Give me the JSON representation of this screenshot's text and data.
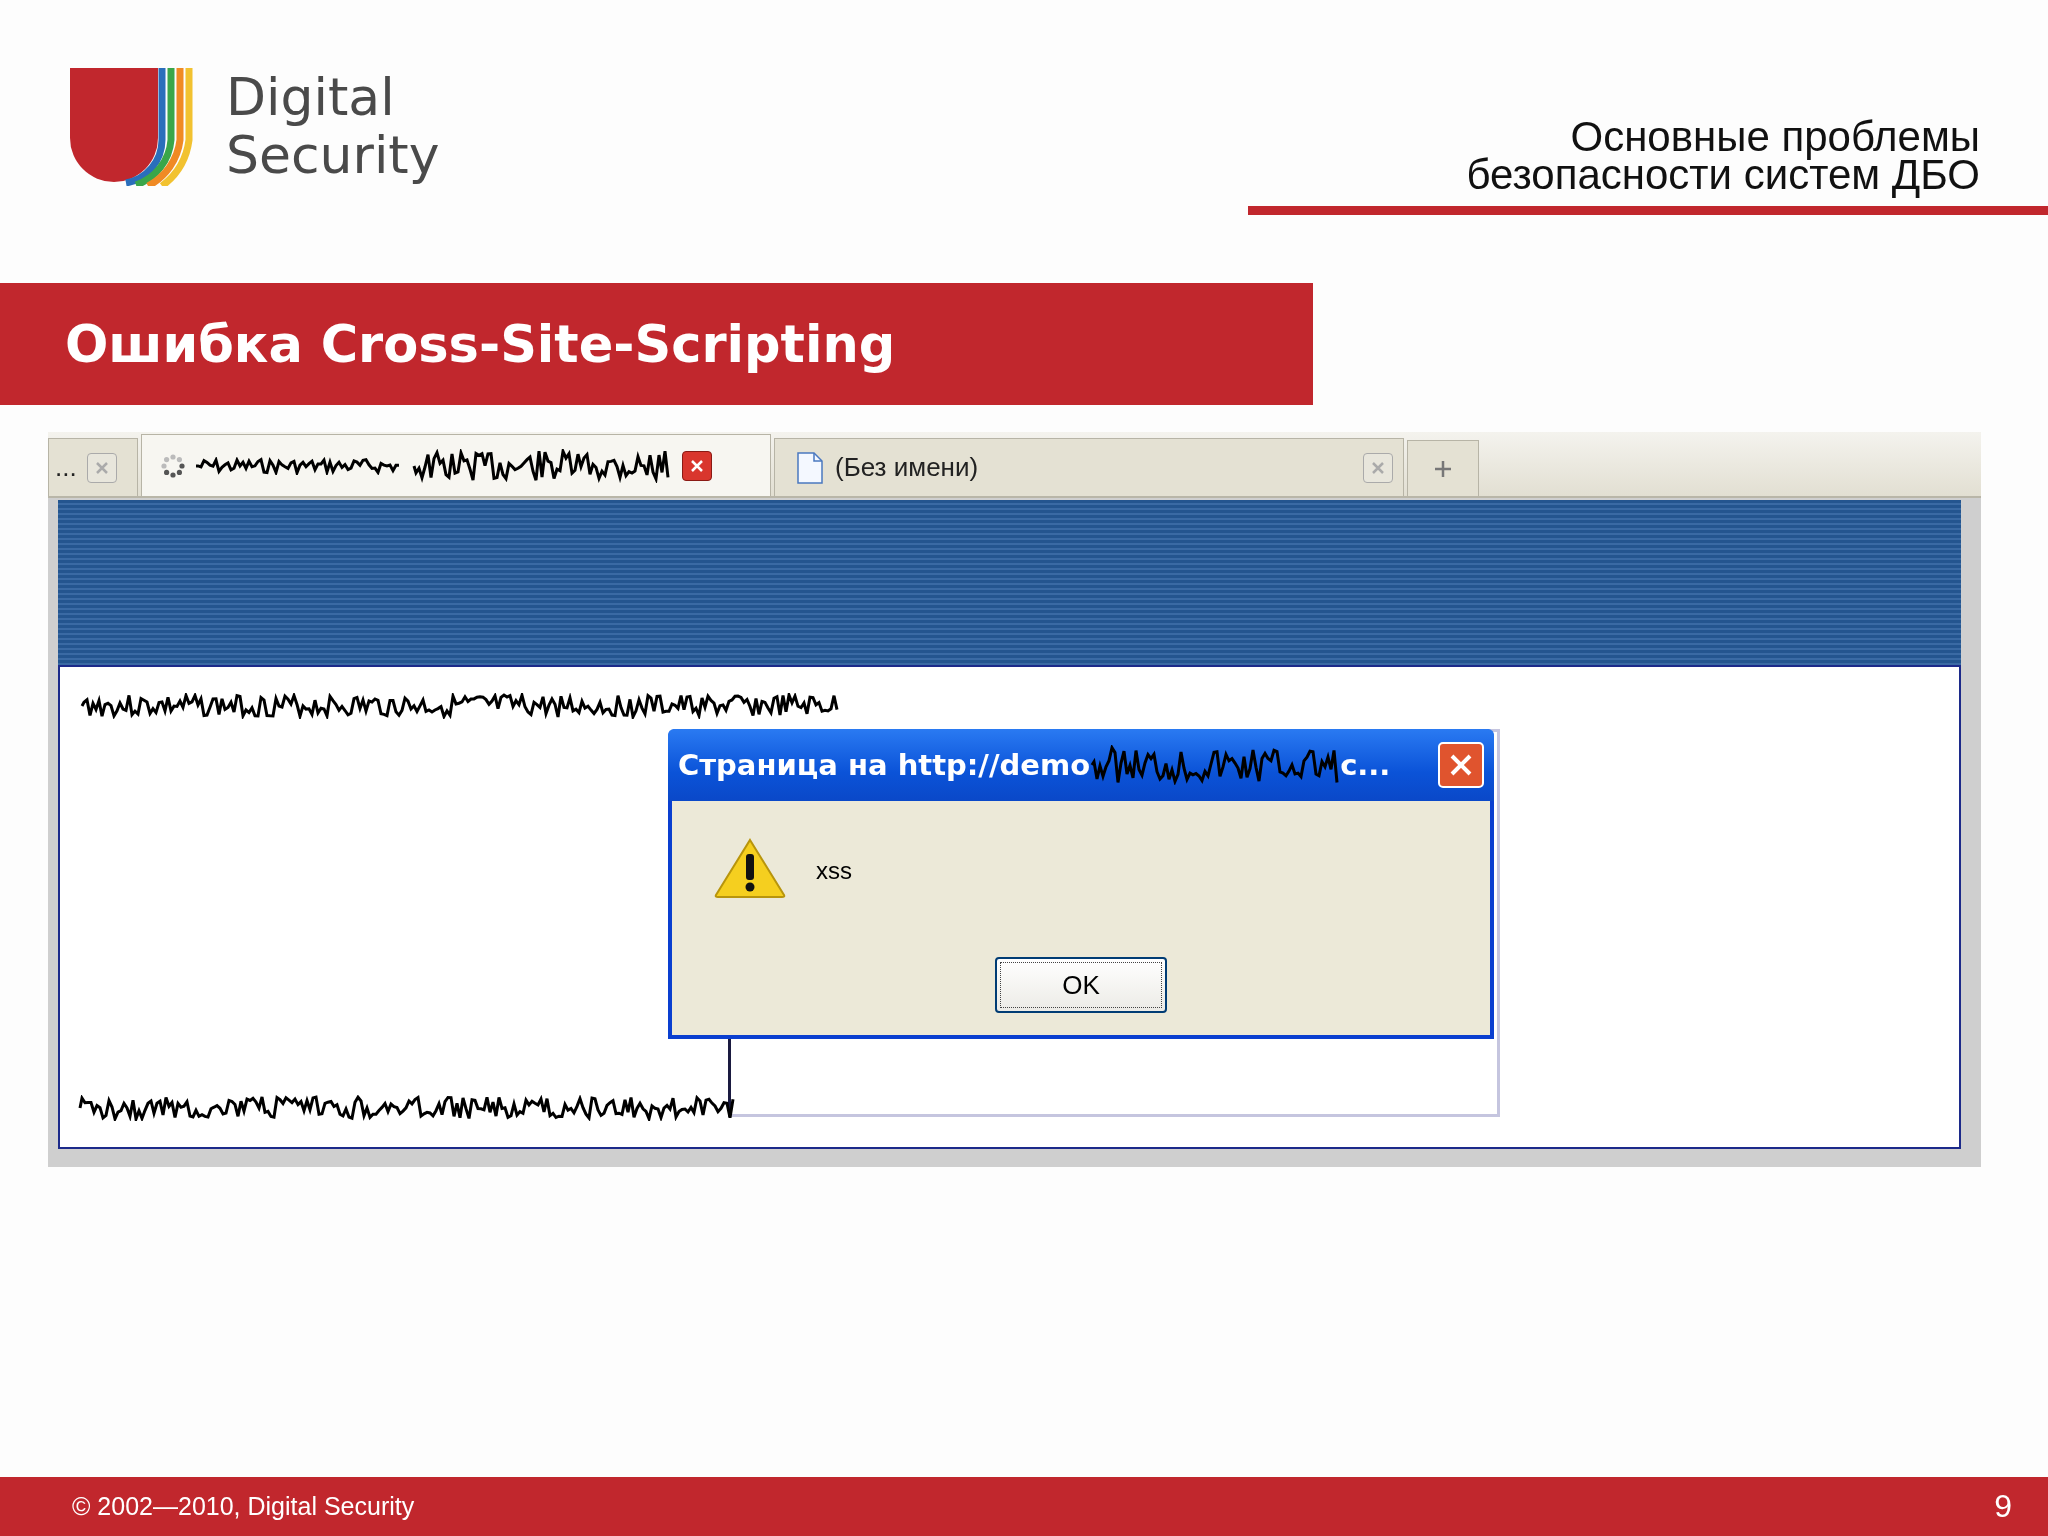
{
  "header": {
    "logo_lines": [
      "Digital",
      "Security"
    ],
    "title_lines": [
      "Основные проблемы",
      "безопасности систем ДБО"
    ]
  },
  "slide_title": "Ошибка Cross-Site-Scripting",
  "browser": {
    "tabs": [
      {
        "kind": "partial",
        "label": "...",
        "selected": false
      },
      {
        "kind": "loading",
        "selected": true
      },
      {
        "kind": "page",
        "label": "(Без имени)",
        "selected": false
      }
    ],
    "dialog": {
      "title": "Страница на http://demo",
      "title_end": "c...",
      "message": "xss",
      "button": "OK"
    }
  },
  "footer": {
    "copyright": "© 2002—2010, Digital Security",
    "page": "9"
  }
}
